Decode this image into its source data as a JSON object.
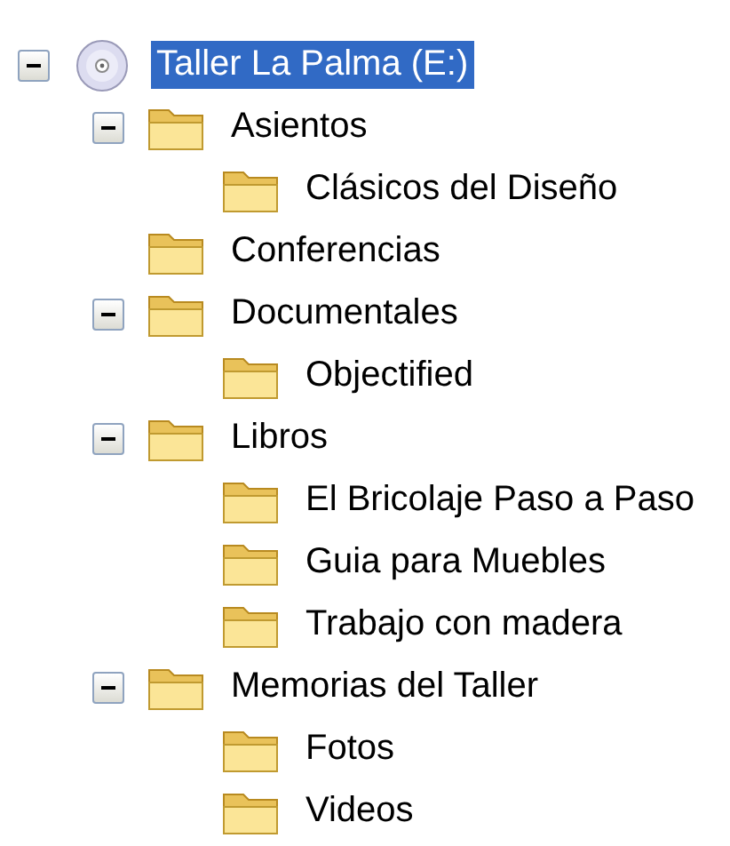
{
  "tree": [
    {
      "kind": "drive",
      "label": "Taller La Palma (E:)",
      "selected": true,
      "expanded": true,
      "children": [
        {
          "kind": "folder",
          "label": "Asientos",
          "selected": false,
          "expanded": true,
          "children": [
            {
              "kind": "folder",
              "label": "Clásicos del Diseño",
              "selected": false
            }
          ]
        },
        {
          "kind": "folder",
          "label": "Conferencias",
          "selected": false
        },
        {
          "kind": "folder",
          "label": "Documentales",
          "selected": false,
          "expanded": true,
          "children": [
            {
              "kind": "folder",
              "label": "Objectified",
              "selected": false
            }
          ]
        },
        {
          "kind": "folder",
          "label": "Libros",
          "selected": false,
          "expanded": true,
          "children": [
            {
              "kind": "folder",
              "label": "El Bricolaje Paso a Paso",
              "selected": false
            },
            {
              "kind": "folder",
              "label": "Guia para Muebles",
              "selected": false
            },
            {
              "kind": "folder",
              "label": "Trabajo con madera",
              "selected": false
            }
          ]
        },
        {
          "kind": "folder",
          "label": "Memorias del Taller",
          "selected": false,
          "expanded": true,
          "children": [
            {
              "kind": "folder",
              "label": "Fotos",
              "selected": false
            },
            {
              "kind": "folder",
              "label": "Videos",
              "selected": false
            }
          ]
        }
      ]
    }
  ]
}
